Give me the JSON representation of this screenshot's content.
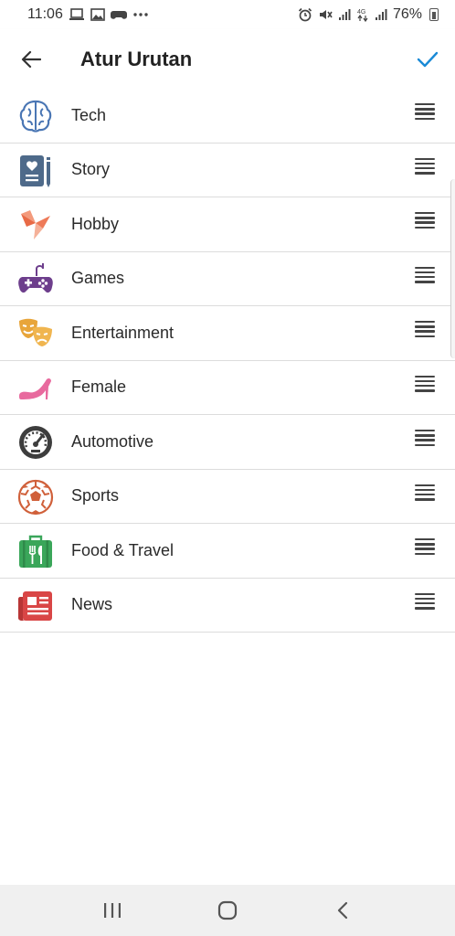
{
  "status_bar": {
    "time": "11:06",
    "battery": "76%",
    "icons_left": [
      "laptop-icon",
      "image-icon",
      "game-controller-icon",
      "more-dots-icon"
    ],
    "icons_right": [
      "alarm-icon",
      "mute-icon",
      "signal-icon",
      "4g-icon",
      "signal-icon",
      "battery-icon"
    ]
  },
  "app_bar": {
    "title": "Atur Urutan",
    "back_icon": "arrow-left-icon",
    "confirm_icon": "check-icon",
    "accent_color": "#1a8ad6"
  },
  "categories": [
    {
      "label": "Tech",
      "icon": "brain-icon",
      "color": "#4a76b4"
    },
    {
      "label": "Story",
      "icon": "notebook-pen-icon",
      "color": "#4e6a8a"
    },
    {
      "label": "Hobby",
      "icon": "origami-bird-icon",
      "color": "#f08060"
    },
    {
      "label": "Games",
      "icon": "gamepad-icon",
      "color": "#6d3e8c"
    },
    {
      "label": "Entertainment",
      "icon": "theater-masks-icon",
      "color": "#e8a53a"
    },
    {
      "label": "Female",
      "icon": "high-heel-icon",
      "color": "#e86a9e"
    },
    {
      "label": "Automotive",
      "icon": "speedometer-icon",
      "color": "#3d3d3d"
    },
    {
      "label": "Sports",
      "icon": "soccer-ball-icon",
      "color": "#d0603a"
    },
    {
      "label": "Food & Travel",
      "icon": "luggage-utensils-icon",
      "color": "#3aa65a"
    },
    {
      "label": "News",
      "icon": "newspaper-icon",
      "color": "#d94646"
    }
  ],
  "nav_bar": {
    "recent_icon": "recent-apps-icon",
    "home_icon": "home-icon",
    "back_icon": "back-chevron-icon"
  }
}
